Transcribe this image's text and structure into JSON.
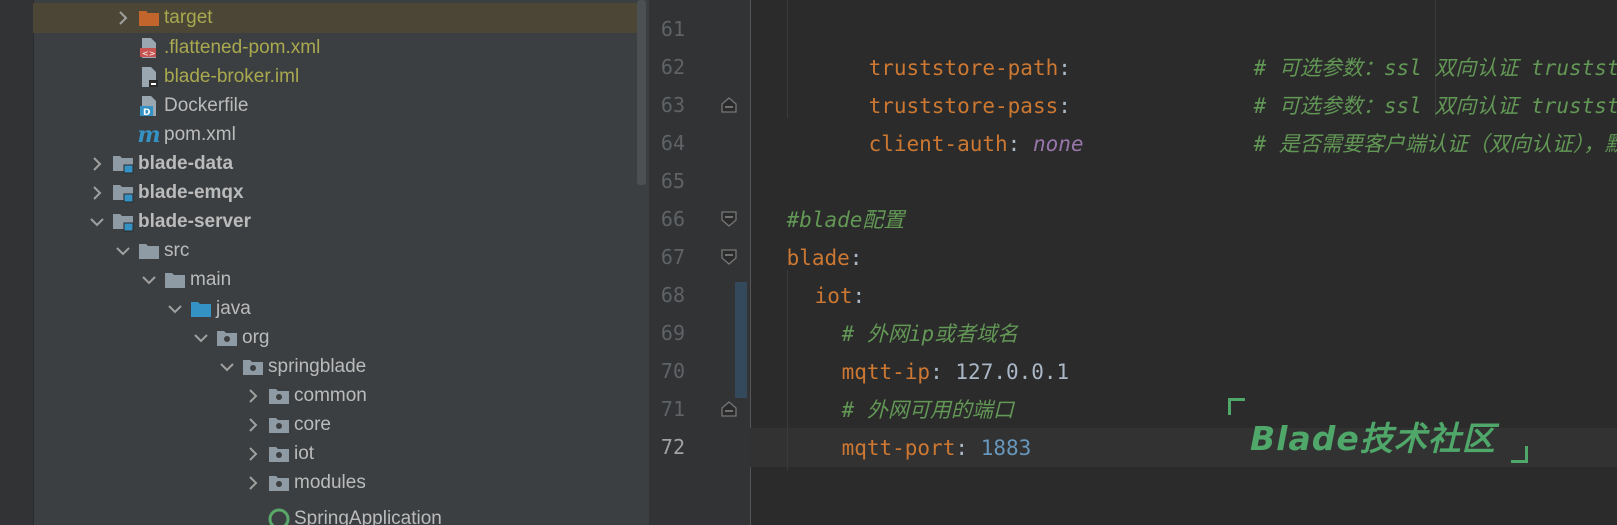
{
  "project_tree": {
    "items": [
      {
        "label": "target",
        "icon": "folder-orange-icon",
        "chevron": "right",
        "style": "olive"
      },
      {
        "label": ".flattened-pom.xml",
        "icon": "xml-file-icon",
        "chevron": "",
        "style": "olive"
      },
      {
        "label": "blade-broker.iml",
        "icon": "iml-file-icon",
        "chevron": "",
        "style": "olive"
      },
      {
        "label": "Dockerfile",
        "icon": "docker-file-icon",
        "chevron": "",
        "style": "normal"
      },
      {
        "label": "pom.xml",
        "icon": "maven-icon",
        "chevron": "",
        "style": "normal"
      },
      {
        "label": "blade-data",
        "icon": "module-folder-icon",
        "chevron": "right",
        "style": "bold"
      },
      {
        "label": "blade-emqx",
        "icon": "module-folder-icon",
        "chevron": "right",
        "style": "bold"
      },
      {
        "label": "blade-server",
        "icon": "module-folder-icon",
        "chevron": "down",
        "style": "bold"
      },
      {
        "label": "src",
        "icon": "folder-icon",
        "chevron": "down",
        "style": "normal"
      },
      {
        "label": "main",
        "icon": "folder-icon",
        "chevron": "down",
        "style": "normal"
      },
      {
        "label": "java",
        "icon": "source-folder-icon",
        "chevron": "down",
        "style": "normal"
      },
      {
        "label": "org",
        "icon": "package-icon",
        "chevron": "down",
        "style": "normal"
      },
      {
        "label": "springblade",
        "icon": "package-icon",
        "chevron": "down",
        "style": "normal"
      },
      {
        "label": "common",
        "icon": "package-icon",
        "chevron": "right",
        "style": "normal"
      },
      {
        "label": "core",
        "icon": "package-icon",
        "chevron": "right",
        "style": "normal"
      },
      {
        "label": "iot",
        "icon": "package-icon",
        "chevron": "right",
        "style": "normal"
      },
      {
        "label": "modules",
        "icon": "package-icon",
        "chevron": "right",
        "style": "normal"
      },
      {
        "label": "SpringApplication",
        "icon": "spring-class-icon",
        "chevron": "",
        "style": "normal"
      }
    ]
  },
  "editor": {
    "line_numbers": [
      "61",
      "62",
      "63",
      "64",
      "65",
      "66",
      "67",
      "68",
      "69",
      "70",
      "71",
      "72"
    ],
    "lines": {
      "l61": {
        "key": "truststore-path",
        "colon": ":",
        "comment": "# 可选参数：ssl 双向认证 truststo"
      },
      "l62": {
        "key": "truststore-pass",
        "colon": ":",
        "comment": "# 可选参数：ssl 双向认证 truststo"
      },
      "l63": {
        "key": "client-auth",
        "colon": ":",
        "value": "none",
        "comment": "# 是否需要客户端认证（双向认证），默"
      },
      "l65": {
        "comment": "#blade配置"
      },
      "l66": {
        "key": "blade",
        "colon": ":"
      },
      "l67": {
        "key": "iot",
        "colon": ":"
      },
      "l68": {
        "comment": "# 外网ip或者域名"
      },
      "l69": {
        "key": "mqtt-ip",
        "colon": ":",
        "value": "127.0.0.1"
      },
      "l70": {
        "comment": "# 外网可用的端口"
      },
      "l71": {
        "key": "mqtt-port",
        "colon": ":",
        "value": "1883"
      }
    }
  },
  "watermark": {
    "text": "Blade技术社区"
  },
  "colors": {
    "tree_bg": "#3c3f41",
    "editor_bg": "#2b2b2b",
    "yaml_key": "#cc7832",
    "comment": "#629755",
    "number": "#6897bb",
    "watermark": "#4fa86a",
    "selection": "#4c4636"
  }
}
